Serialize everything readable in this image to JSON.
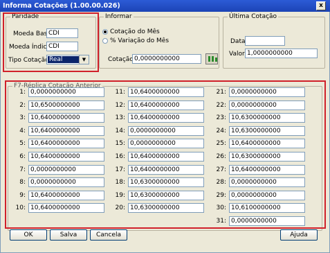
{
  "window": {
    "title": "Informa Cotações (1.00.00.026)",
    "close_label": "x"
  },
  "paridade": {
    "legend": "Paridade",
    "moeda_base_label": "Moeda Base:",
    "moeda_base_value": "CDI",
    "moeda_indice_label": "Moeda Índice:",
    "moeda_indice_value": "CDI",
    "tipo_cotacao_label": "Tipo Cotação:",
    "tipo_cotacao_value": "Real"
  },
  "informar": {
    "legend": "Informar",
    "radio1_label": "Cotação do Mês",
    "radio2_label": "% Variação do Mês",
    "cotacao_label": "Cotação:",
    "cotacao_value": "0,0000000000"
  },
  "ultima": {
    "legend": "Última Cotação",
    "data_label": "Data:",
    "data_value": "",
    "valor_label": "Valor:",
    "valor_value": "1,0000000000"
  },
  "replica": {
    "label": "F7-Réplica Cotação Anterior"
  },
  "days": [
    {
      "n": "1:",
      "v": "0,0000000000"
    },
    {
      "n": "2:",
      "v": "10,6500000000"
    },
    {
      "n": "3:",
      "v": "10,6400000000"
    },
    {
      "n": "4:",
      "v": "10,6400000000"
    },
    {
      "n": "5:",
      "v": "10,6400000000"
    },
    {
      "n": "6:",
      "v": "10,6400000000"
    },
    {
      "n": "7:",
      "v": "0,0000000000"
    },
    {
      "n": "8:",
      "v": "0,0000000000"
    },
    {
      "n": "9:",
      "v": "10,6400000000"
    },
    {
      "n": "10:",
      "v": "10,6400000000"
    },
    {
      "n": "11:",
      "v": "10,6400000000"
    },
    {
      "n": "12:",
      "v": "10,6400000000"
    },
    {
      "n": "13:",
      "v": "10,6400000000"
    },
    {
      "n": "14:",
      "v": "0,0000000000"
    },
    {
      "n": "15:",
      "v": "0,0000000000"
    },
    {
      "n": "16:",
      "v": "10,6400000000"
    },
    {
      "n": "17:",
      "v": "10,6400000000"
    },
    {
      "n": "18:",
      "v": "10,6300000000"
    },
    {
      "n": "19:",
      "v": "10,6300000000"
    },
    {
      "n": "20:",
      "v": "10,6300000000"
    },
    {
      "n": "21:",
      "v": "0,0000000000"
    },
    {
      "n": "22:",
      "v": "0,0000000000"
    },
    {
      "n": "23:",
      "v": "10,6300000000"
    },
    {
      "n": "24:",
      "v": "10,6300000000"
    },
    {
      "n": "25:",
      "v": "10,6400000000"
    },
    {
      "n": "26:",
      "v": "10,6300000000"
    },
    {
      "n": "27:",
      "v": "10,6400000000"
    },
    {
      "n": "28:",
      "v": "0,0000000000"
    },
    {
      "n": "29:",
      "v": "0,0000000000"
    },
    {
      "n": "30:",
      "v": "10,6100000000"
    },
    {
      "n": "31:",
      "v": "0,0000000000"
    }
  ],
  "buttons": {
    "ok": "OK",
    "salva": "Salva",
    "cancela": "Cancela",
    "ajuda": "Ajuda"
  },
  "colors": {
    "highlight": "#d0202a",
    "titlebar": "#1c44b5",
    "window_bg": "#ece9d8"
  }
}
